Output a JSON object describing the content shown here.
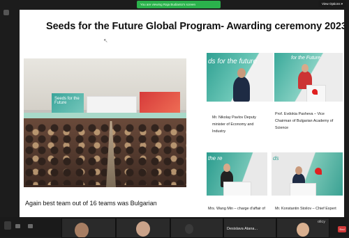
{
  "top_bar": {
    "share_text": "You are viewing Raja Budianto's screen",
    "view_options_label": "View Options ▾"
  },
  "slide": {
    "title": "Seeds for the Future Global Program- Awarding ceremony 2023",
    "main_caption": "Again best team out of 16 teams was Bulgarian",
    "main_photo_screen_text": "Seeds for the Future"
  },
  "photos": [
    {
      "caption_lines": [
        "Mr. Nikolay Pavlov Deputy",
        "minister of Economy and",
        "Industry"
      ],
      "sign_text": "ds for the future"
    },
    {
      "caption_lines": [
        "Prof. Evdokia Pasheva – Vice",
        "Chairman of Bulgarian Academy of",
        "Science"
      ],
      "sign_text": "for the Future"
    },
    {
      "caption_lines": [
        "Mrs. Wang Min – charge d'affair of"
      ],
      "sign_text": "the re"
    },
    {
      "caption_lines": [
        "Mr. Konstantin Stoilov – Chief Expert"
      ],
      "sign_text": "ds"
    }
  ],
  "bottom_bar": {
    "participant_name": "Desislava Atana...",
    "right_caption_fragment": "olicy",
    "end_label": "End"
  },
  "colors": {
    "banner_green": "#2bb24c",
    "teal": "#2fa092",
    "huawei_red": "#e02020"
  }
}
